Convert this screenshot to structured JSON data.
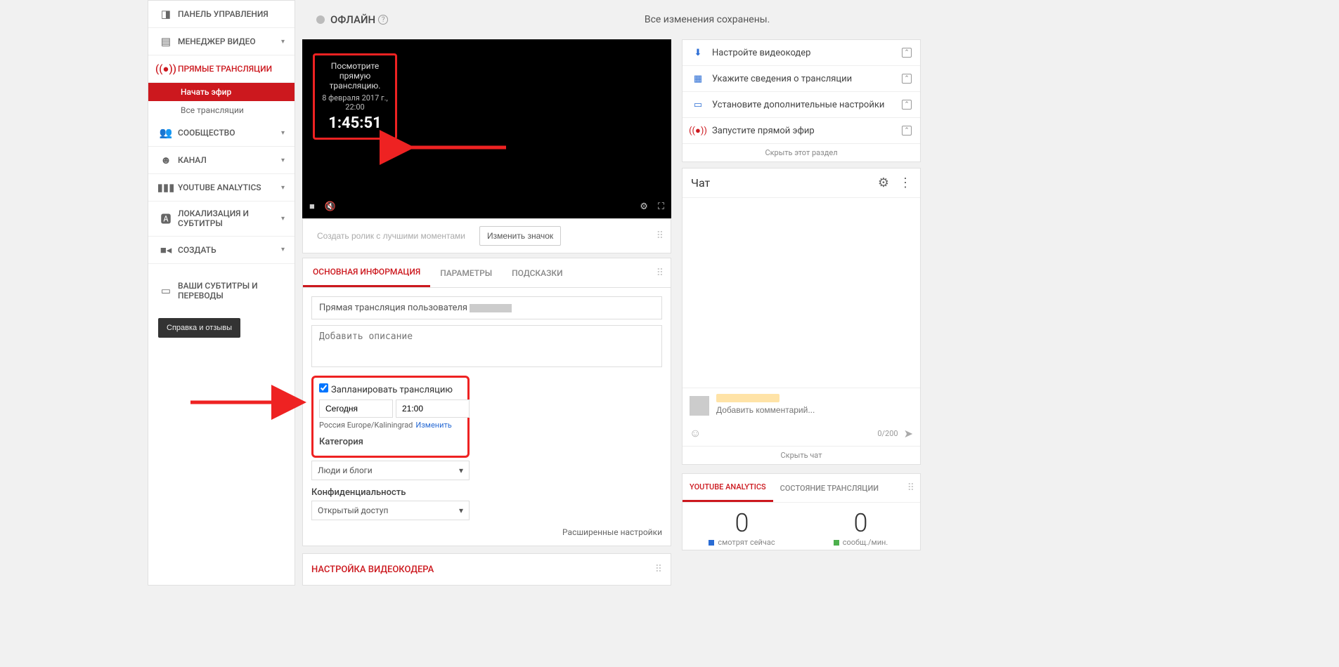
{
  "sidebar": {
    "items": [
      {
        "label": "ПАНЕЛЬ УПРАВЛЕНИЯ"
      },
      {
        "label": "МЕНЕДЖЕР ВИДЕО"
      },
      {
        "label": "ПРЯМЫЕ ТРАНСЛЯЦИИ"
      },
      {
        "label": "СООБЩЕСТВО"
      },
      {
        "label": "КАНАЛ"
      },
      {
        "label": "YOUTUBE ANALYTICS"
      },
      {
        "label": "ЛОКАЛИЗАЦИЯ И СУБТИТРЫ"
      },
      {
        "label": "СОЗДАТЬ"
      },
      {
        "label": "ВАШИ СУБТИТРЫ И ПЕРЕВОДЫ"
      }
    ],
    "subs": {
      "start": "Начать эфир",
      "all": "Все трансляции"
    },
    "feedback": "Справка и отзывы"
  },
  "top": {
    "status": "ОФЛАЙН",
    "saved": "Все изменения сохранены."
  },
  "player": {
    "line1": "Посмотрите прямую трансляцию.",
    "date": "8 февраля 2017 г., 22:00",
    "countdown": "1:45:51"
  },
  "under": {
    "highlight": "Создать ролик с лучшими моментами",
    "thumb": "Изменить значок"
  },
  "tabs": {
    "basic": "ОСНОВНАЯ ИНФОРМАЦИЯ",
    "params": "ПАРАМЕТРЫ",
    "cards": "ПОДСКАЗКИ"
  },
  "form": {
    "title_prefix": "Прямая трансляция пользователя ",
    "desc_placeholder": "Добавить описание",
    "schedule_chk": "Запланировать трансляцию",
    "date": "Сегодня",
    "time": "21:00",
    "tz": "Россия Europe/Kaliningrad",
    "tz_change": "Изменить",
    "category_lbl": "Категория",
    "category_val": "Люди и блоги",
    "privacy_lbl": "Конфиденциальность",
    "privacy_val": "Открытый доступ",
    "advanced": "Расширенные настройки"
  },
  "encoder": {
    "title": "НАСТРОЙКА ВИДЕОКОДЕРА"
  },
  "checklist": {
    "r1": "Настройте видеокодер",
    "r2": "Укажите сведения о трансляции",
    "r3": "Установите дополнительные настройки",
    "r4": "Запустите прямой эфир",
    "hide": "Скрыть этот раздел"
  },
  "chat": {
    "title": "Чат",
    "placeholder": "Добавить комментарий...",
    "count": "0/200",
    "hide": "Скрыть чат"
  },
  "analytics": {
    "tab1": "YOUTUBE ANALYTICS",
    "tab2": "СОСТОЯНИЕ ТРАНСЛЯЦИИ",
    "n1": "0",
    "l1": "смотрят сейчас",
    "n2": "0",
    "l2": "сообщ./мин."
  }
}
